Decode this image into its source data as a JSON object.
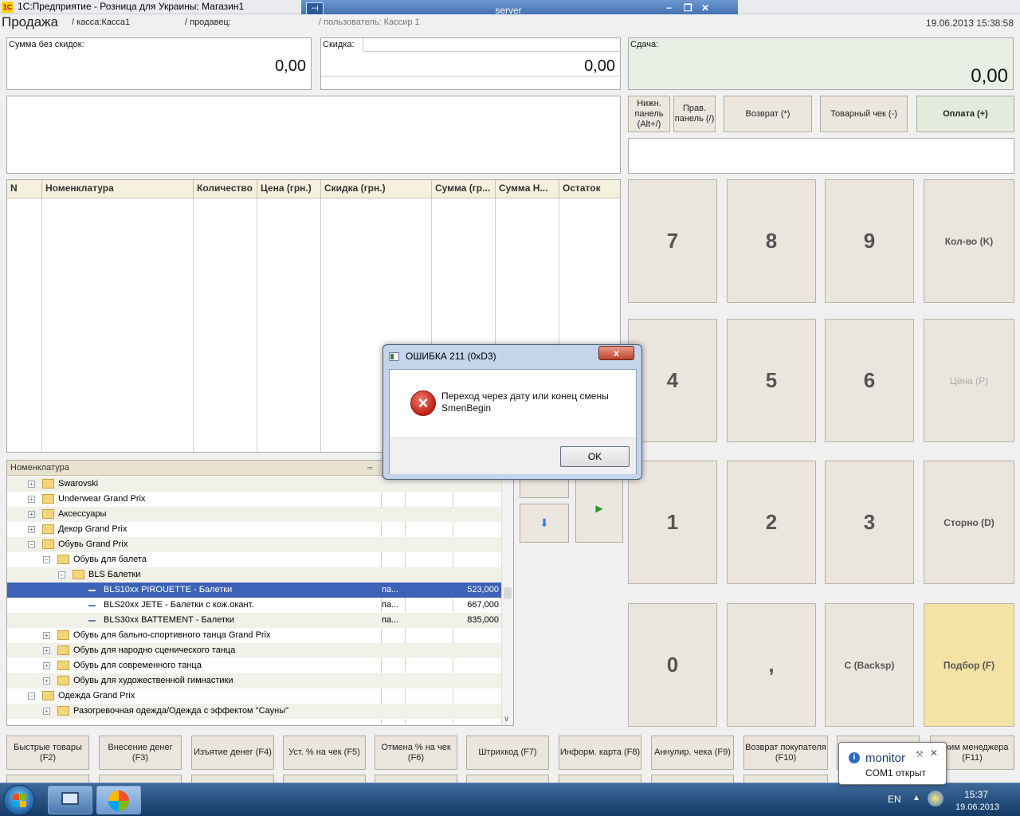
{
  "app": {
    "title": "1С:Предприятие - Розница для Украины: Магазин1",
    "logo": "1С",
    "rdp_server": "server",
    "rdp_pin": "⊣"
  },
  "header": {
    "operation": "Продажа",
    "kassa": "/ касса:Касса1",
    "seller": "/ продавец:",
    "user": "/ пользователь: Кассир 1",
    "datetime": "19.06.2013 15:38:58"
  },
  "totals": {
    "sum_label": "Сумма без скидок:",
    "sum_value": "0,00",
    "discount_label": "Скидка:",
    "discount_value": "0,00",
    "change_label": "Сдача:",
    "change_value": "0,00"
  },
  "panel_buttons": {
    "bottom_panel": "Нижн. панель (Alt+/)",
    "right_panel": "Прав. панель (/)",
    "return": "Возврат (*)",
    "receipt": "Товарный чек (-)",
    "payment": "Оплата (+)"
  },
  "keypad": {
    "k7": "7",
    "k8": "8",
    "k9": "9",
    "qty": "Кол-во (K)",
    "k4": "4",
    "k5": "5",
    "k6": "6",
    "price": "Цена (P)",
    "k1": "1",
    "k2": "2",
    "k3": "3",
    "storno": "Сторно (D)",
    "k0": "0",
    "comma": ",",
    "backsp": "C (Backsp)",
    "select": "Подбор (F)"
  },
  "receipt_table": {
    "columns": [
      "N",
      "Номенклатура",
      "Количество",
      "Цена (грн.)",
      "Скидка (грн.)",
      "Сумма (гр...",
      "Сумма Н...",
      "Остаток"
    ]
  },
  "tree": {
    "header": "Номенклатура",
    "rows": [
      {
        "text": "Swarovski",
        "unit": "",
        "price": ""
      },
      {
        "text": "Underwear Grand Prix",
        "unit": "",
        "price": ""
      },
      {
        "text": "Аксессуары",
        "unit": "",
        "price": ""
      },
      {
        "text": "Декор Grand Prix",
        "unit": "",
        "price": ""
      },
      {
        "text": "Обувь Grand Prix",
        "unit": "",
        "price": ""
      },
      {
        "text": "Обувь для балета",
        "unit": "",
        "price": ""
      },
      {
        "text": "BLS Балетки",
        "unit": "",
        "price": ""
      },
      {
        "text": "BLS10xx PIROUETTE - Балетки",
        "unit": "па...",
        "price": "523,000"
      },
      {
        "text": "BLS20xx JETE - Балетки с кож.окант.",
        "unit": "па...",
        "price": "667,000"
      },
      {
        "text": "BLS30xx BATTEMENT - Балетки",
        "unit": "па...",
        "price": "835,000"
      },
      {
        "text": "Обувь для бально-спортивного танца Grand Prix",
        "unit": "",
        "price": ""
      },
      {
        "text": "Обувь для народно сценического танца",
        "unit": "",
        "price": ""
      },
      {
        "text": "Обувь для современного танца",
        "unit": "",
        "price": ""
      },
      {
        "text": "Обувь для художественной гимнастики",
        "unit": "",
        "price": ""
      },
      {
        "text": "Одежда Grand Prix",
        "unit": "",
        "price": ""
      },
      {
        "text": "Разогревочная одежда/Одежда с эффектом \"Сауны\"",
        "unit": "",
        "price": ""
      }
    ]
  },
  "function_buttons": [
    "Быстрые товары (F2)",
    "Внесение денег (F3)",
    "Изъятие денег (F4)",
    "Уст. % на чек (F5)",
    "Отмена % на чек (F6)",
    "Штрихкод (F7)",
    "Информ. карта (F8)",
    "Аннулир. чека (F9)",
    "Возврат покупателя (F10)",
    "",
    "...жим менеджера (F11)"
  ],
  "dialog": {
    "title": "ОШИБКА 211 (0xD3)",
    "message_line1": "Переход через дату или конец смены",
    "message_line2": "SmenBegin",
    "ok": "OK",
    "close": "x"
  },
  "tooltip": {
    "title": "monitor",
    "text": "COM1 открыт"
  },
  "taskbar": {
    "lang": "EN",
    "time": "15:37",
    "date": "19.06.2013"
  }
}
